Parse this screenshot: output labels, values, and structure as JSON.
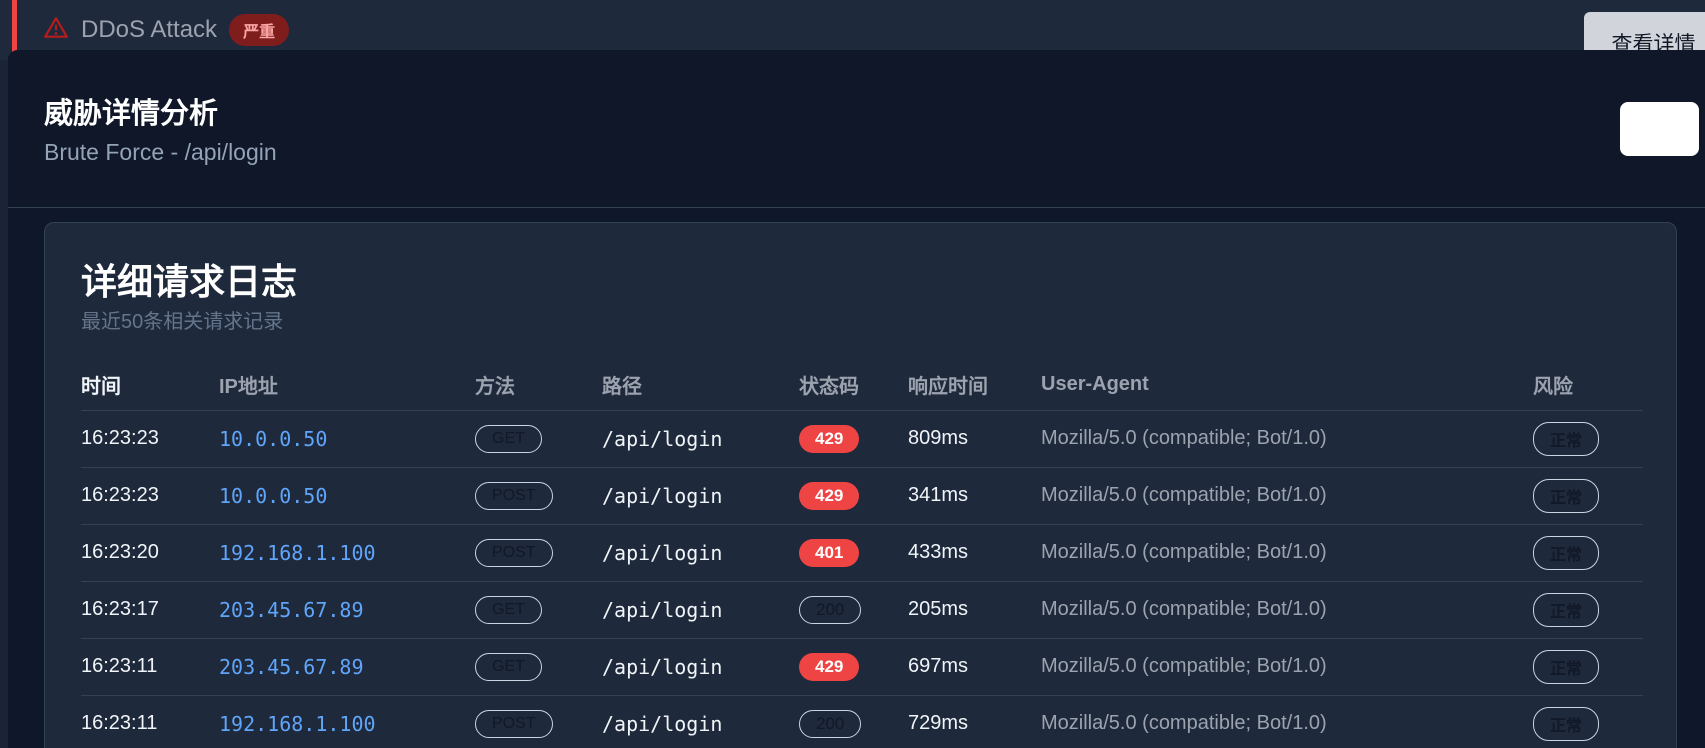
{
  "background_alert": {
    "title": "DDoS Attack",
    "severity": "严重",
    "detail_button": "查看详情",
    "accent_color": "#ef4444"
  },
  "modal": {
    "title": "威胁详情分析",
    "subtitle": "Brute Force - /api/login"
  },
  "log_card": {
    "title": "详细请求日志",
    "subtitle": "最近50条相关请求记录",
    "columns": [
      "时间",
      "IP地址",
      "方法",
      "路径",
      "状态码",
      "响应时间",
      "User-Agent",
      "风险"
    ],
    "rows": [
      {
        "time": "16:23:23",
        "ip": "10.0.0.50",
        "method": "GET",
        "path": "/api/login",
        "status": "429",
        "status_kind": "err",
        "response": "809ms",
        "ua": "Mozilla/5.0 (compatible; Bot/1.0)",
        "risk": "正常"
      },
      {
        "time": "16:23:23",
        "ip": "10.0.0.50",
        "method": "POST",
        "path": "/api/login",
        "status": "429",
        "status_kind": "err",
        "response": "341ms",
        "ua": "Mozilla/5.0 (compatible; Bot/1.0)",
        "risk": "正常"
      },
      {
        "time": "16:23:20",
        "ip": "192.168.1.100",
        "method": "POST",
        "path": "/api/login",
        "status": "401",
        "status_kind": "err",
        "response": "433ms",
        "ua": "Mozilla/5.0 (compatible; Bot/1.0)",
        "risk": "正常"
      },
      {
        "time": "16:23:17",
        "ip": "203.45.67.89",
        "method": "GET",
        "path": "/api/login",
        "status": "200",
        "status_kind": "ok",
        "response": "205ms",
        "ua": "Mozilla/5.0 (compatible; Bot/1.0)",
        "risk": "正常"
      },
      {
        "time": "16:23:11",
        "ip": "203.45.67.89",
        "method": "GET",
        "path": "/api/login",
        "status": "429",
        "status_kind": "err",
        "response": "697ms",
        "ua": "Mozilla/5.0 (compatible; Bot/1.0)",
        "risk": "正常"
      },
      {
        "time": "16:23:11",
        "ip": "192.168.1.100",
        "method": "POST",
        "path": "/api/login",
        "status": "200",
        "status_kind": "ok",
        "response": "729ms",
        "ua": "Mozilla/5.0 (compatible; Bot/1.0)",
        "risk": "正常"
      }
    ]
  }
}
